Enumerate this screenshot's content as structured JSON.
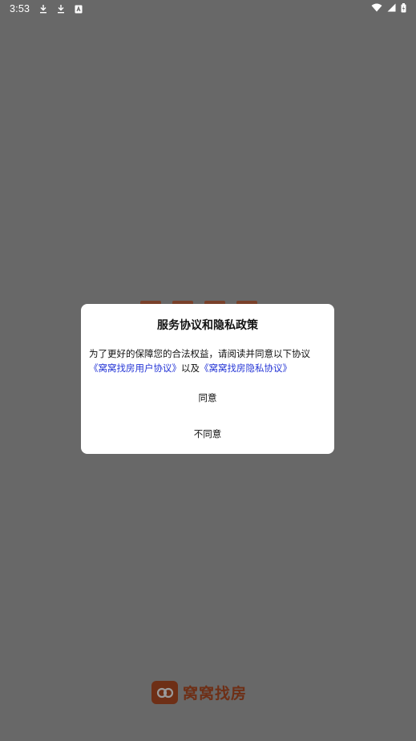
{
  "status_bar": {
    "time": "3:53",
    "left_icons": [
      "download-icon",
      "download-icon",
      "a-box-icon"
    ],
    "right_icons": [
      "wifi-icon",
      "signal-icon",
      "battery-icon"
    ]
  },
  "dialog": {
    "title": "服务协议和隐私政策",
    "body_text": "为了更好的保障您的合法权益，请阅读并同意以下协议",
    "user_agreement_link": "《窝窝找房用户协议》",
    "conjunction": "以及",
    "privacy_link": "《窝窝找房隐私协议》",
    "agree_label": "同意",
    "disagree_label": "不同意"
  },
  "brand": {
    "name": "窝窝找房",
    "logo_icon": "house-logo-icon"
  },
  "colors": {
    "overlay": "#686868",
    "link": "#2435d6",
    "brand": "#6e2f16"
  }
}
